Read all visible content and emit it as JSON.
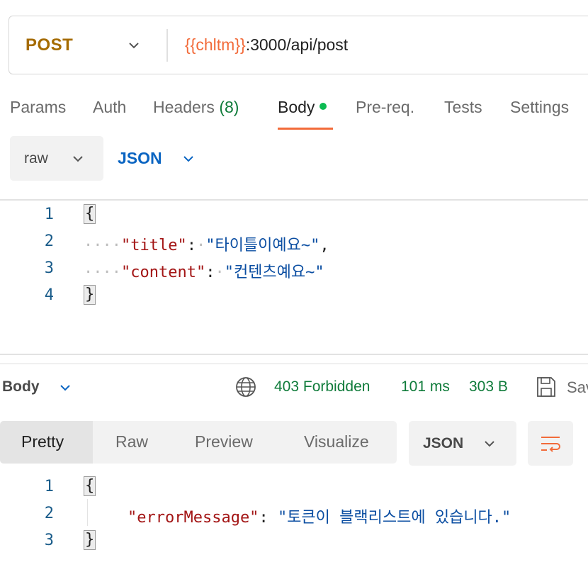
{
  "request": {
    "method": "POST",
    "url_variable": "{{chltm}}",
    "url_rest": ":3000/api/post"
  },
  "request_tabs": {
    "params": "Params",
    "auth": "Auth",
    "headers": "Headers",
    "headers_count": "(8)",
    "body": "Body",
    "prereq": "Pre-req.",
    "tests": "Tests",
    "settings": "Settings"
  },
  "body_mode": {
    "mode": "raw",
    "language": "JSON"
  },
  "request_body": {
    "line_numbers": [
      "1",
      "2",
      "3",
      "4"
    ],
    "open_brace": "{",
    "close_brace": "}",
    "key1": "\"title\"",
    "value1": "\"타이틀이예요~\"",
    "key2": "\"content\"",
    "value2": "\"컨텐츠예요~\""
  },
  "response": {
    "title": "Body",
    "status": "403 Forbidden",
    "time": "101 ms",
    "size": "303 B",
    "save_label": "Save",
    "view_tabs": [
      "Pretty",
      "Raw",
      "Preview",
      "Visualize"
    ],
    "format": "JSON",
    "line_numbers": [
      "1",
      "2",
      "3"
    ],
    "open_brace": "{",
    "close_brace": "}",
    "key": "\"errorMessage\"",
    "value": "\"토큰이 블랙리스트에 있습니다.\""
  },
  "colors": {
    "method": "#a56c00",
    "url_variable": "#f26b3a",
    "accent": "#f26b3a",
    "status_ok_green": "#0f7b3a",
    "json_key": "#a31515",
    "json_string": "#0b4ea2"
  }
}
